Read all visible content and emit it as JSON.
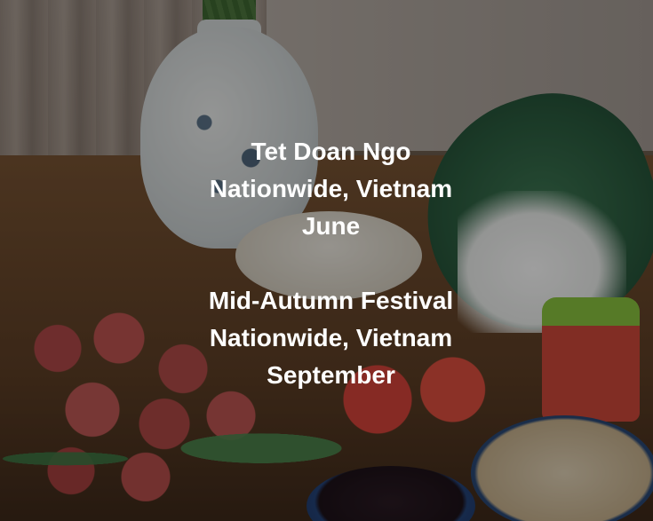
{
  "events": [
    {
      "name": "Tet Doan Ngo",
      "location": "Nationwide, Vietnam",
      "month": "June"
    },
    {
      "name": "Mid-Autumn Festival",
      "location": "Nationwide, Vietnam",
      "month": "September"
    }
  ]
}
